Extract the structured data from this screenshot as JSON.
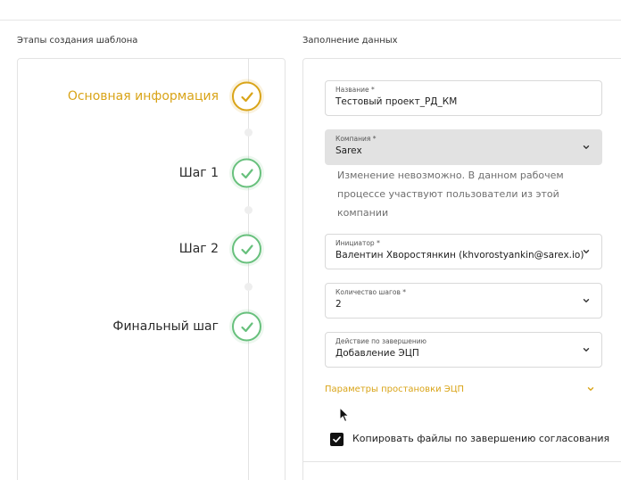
{
  "left_section": {
    "title": "Этапы создания шаблона",
    "steps": [
      {
        "label": "Основная информация",
        "state": "active"
      },
      {
        "label": "Шаг 1",
        "state": "done"
      },
      {
        "label": "Шаг 2",
        "state": "done"
      },
      {
        "label": "Финальный шаг",
        "state": "done"
      }
    ]
  },
  "right_section": {
    "title": "Заполнение данных",
    "fields": {
      "name": {
        "label": "Название *",
        "value": "Тестовый проект_РД_КМ"
      },
      "company": {
        "label": "Компания *",
        "value": "Sarex",
        "disabled": true
      },
      "company_helper": "Изменение невозможно. В данном рабочем процессе участвуют пользователи из этой компании",
      "initiator": {
        "label": "Инициатор *",
        "value": "Валентин Хворостянкин (khvorostyankin@sarex.io)"
      },
      "steps_count": {
        "label": "Количество шагов *",
        "value": "2"
      },
      "completion_action": {
        "label": "Действие по завершению",
        "value": "Добавление ЭЦП"
      }
    },
    "signature_params_label": "Параметры простановки ЭЦП",
    "copy_files_checkbox": {
      "label": "Копировать файлы по завершению согласования",
      "checked": true
    }
  },
  "colors": {
    "accent": "#d9a418",
    "success": "#67c07c",
    "disabled_bg": "#e2e2e2"
  },
  "icons": [
    "check-icon",
    "chevron-down-icon",
    "cursor-arrow-icon"
  ]
}
